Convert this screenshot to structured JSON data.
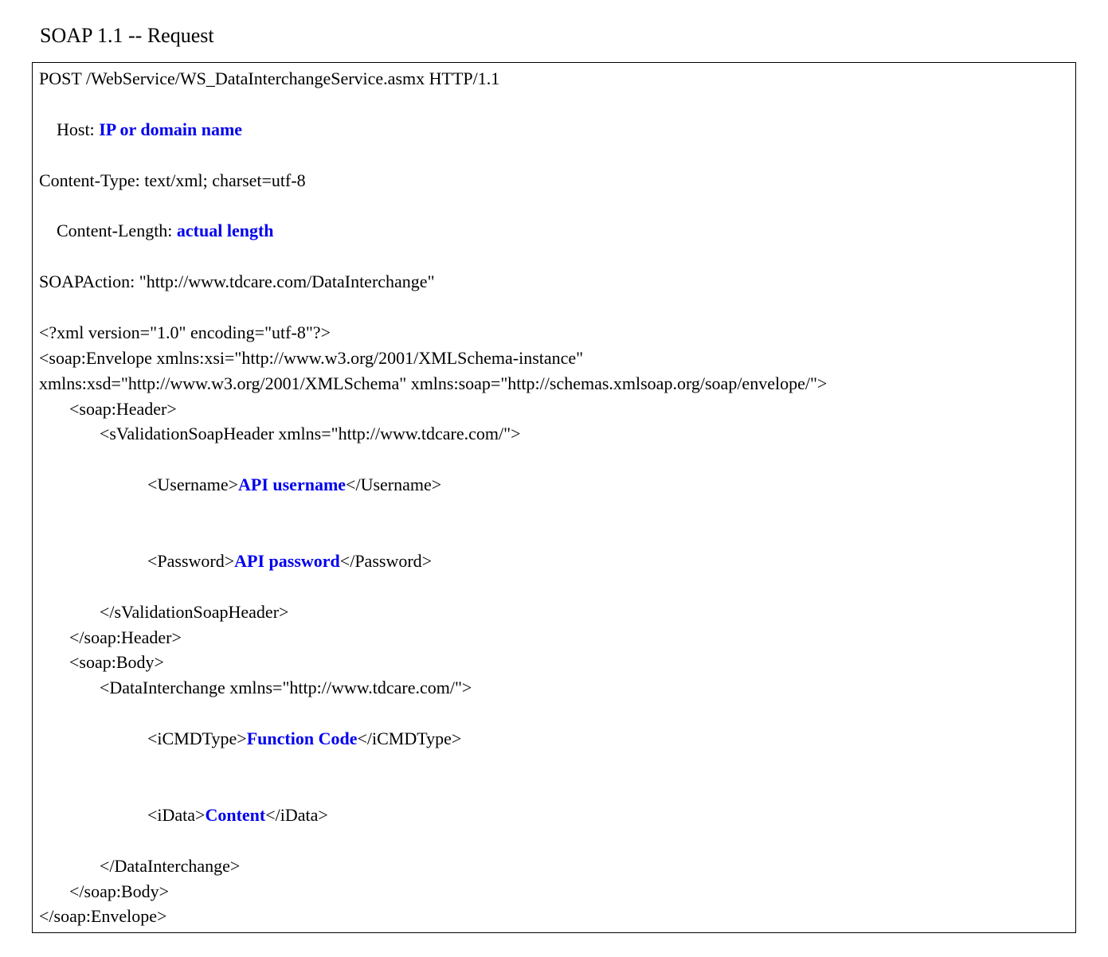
{
  "title": "SOAP 1.1 -- Request",
  "request_line": "POST /WebService/WS_DataInterchangeService.asmx HTTP/1.1",
  "host_label": "Host: ",
  "host_value": "IP or domain name",
  "content_type": "Content-Type: text/xml; charset=utf-8",
  "content_length_label": "Content-Length: ",
  "content_length_value": "actual length",
  "soap_action": "SOAPAction: \"http://www.tdcare.com/DataInterchange\"",
  "xml_decl": "<?xml version=\"1.0\" encoding=\"utf-8\"?>",
  "envelope_open_1": "<soap:Envelope xmlns:xsi=\"http://www.w3.org/2001/XMLSchema-instance\"",
  "envelope_open_2": "xmlns:xsd=\"http://www.w3.org/2001/XMLSchema\" xmlns:soap=\"http://schemas.xmlsoap.org/soap/envelope/\">",
  "header_open": "<soap:Header>",
  "validation_open": "<sValidationSoapHeader xmlns=\"http://www.tdcare.com/\">",
  "username_open": "<Username>",
  "username_value": "API username",
  "username_close": "</Username>",
  "password_open": "<Password>",
  "password_value": "API password",
  "password_close": "</Password>",
  "validation_close": "</sValidationSoapHeader>",
  "header_close": "</soap:Header>",
  "body_open": "<soap:Body>",
  "datainterchange_open": "<DataInterchange xmlns=\"http://www.tdcare.com/\">",
  "icmdtype_open": "<iCMDType>",
  "icmdtype_value": "Function Code",
  "icmdtype_close": "</iCMDType>",
  "idata_open": "<iData>",
  "idata_value": "Content",
  "idata_close": "</iData>",
  "datainterchange_close": "</DataInterchange>",
  "body_close": "</soap:Body>",
  "envelope_close": "</soap:Envelope>"
}
